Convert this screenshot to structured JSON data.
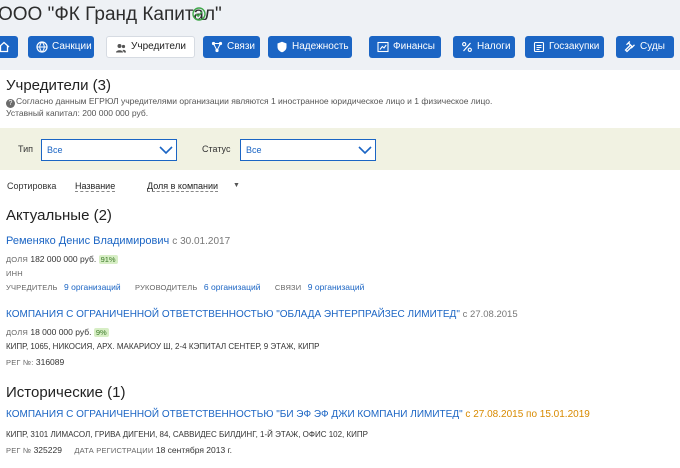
{
  "header": {
    "company_name": "ООО \"ФК Гранд Капитал\""
  },
  "tabs": [
    {
      "label": "",
      "icon": "home-icon"
    },
    {
      "label": "Санкции",
      "icon": "globe-icon"
    },
    {
      "label": "Учредители",
      "icon": "users-icon",
      "active": true
    },
    {
      "label": "Связи",
      "icon": "network-icon"
    },
    {
      "label": "Надежность",
      "icon": "shield-icon"
    },
    {
      "label": "Финансы",
      "icon": "chart-icon"
    },
    {
      "label": "Налоги",
      "icon": "percent-icon"
    },
    {
      "label": "Госзакупки",
      "icon": "document-icon"
    },
    {
      "label": "Суды",
      "icon": "gavel-icon"
    }
  ],
  "founders": {
    "title": "Учредители (3)",
    "note": "Согласно данным ЕГРЮЛ учредителями организации являются 1 иностранное юридическое лицо и 1 физическое лицо.",
    "capital": "Уставный капитал: 200 000 000 руб."
  },
  "filters": {
    "type_label": "Тип",
    "type_value": "Все",
    "status_label": "Статус",
    "status_value": "Все"
  },
  "sort": {
    "label": "Сортировка",
    "by_name": "Название",
    "by_share": "Доля в компании"
  },
  "actual": {
    "title": "Актуальные (2)",
    "person": {
      "name": "Ременяко Денис Владимирович",
      "since": "с 30.01.2017",
      "share_label": "ДОЛЯ",
      "share_value": "182 000 000 руб.",
      "share_pct": "91%",
      "inn_label": "ИНН",
      "founder_label": "УЧРЕДИТЕЛЬ",
      "founder_link": "9 организаций",
      "head_label": "РУКОВОДИТЕЛЬ",
      "head_link": "6 организаций",
      "links_label": "СВЯЗИ",
      "links_link": "9 организаций"
    },
    "company": {
      "name": "КОМПАНИЯ С ОГРАНИЧЕННОЙ ОТВЕТСТВЕННОСТЬЮ \"ОБЛАДА ЭНТЕРПРАЙЗЕС ЛИМИТЕД\"",
      "since": "с 27.08.2015",
      "share_label": "ДОЛЯ",
      "share_value": "18 000 000 руб.",
      "share_pct": "9%",
      "address": "КИПР, 1065, НИКОСИЯ, АРХ. МАКАРИОУ Ш, 2-4 КЭПИТАЛ СЕНТЕР, 9 ЭТАЖ, КИПР",
      "reg_label": "РЕГ №:",
      "reg_value": "316089"
    }
  },
  "historical": {
    "title": "Исторические (1)",
    "company": {
      "name": "КОМПАНИЯ С ОГРАНИЧЕННОЙ ОТВЕТСТВЕННОСТЬЮ \"БИ ЭФ ЭФ ДЖИ КОМПАНИ ЛИМИТЕД\"",
      "period": "с 27.08.2015 по 15.01.2019",
      "address": "КИПР, 3101 ЛИМАСОЛ, ГРИВА ДИГЕНИ, 84, САВВИДЕС БИЛДИНГ, 1-Й ЭТАЖ, ОФИС 102, КИПР",
      "reg_label": "РЕГ №",
      "reg_value": "325229",
      "date_label": "ДАТА РЕГИСТРАЦИИ",
      "date_value": "18 сентября 2013 г."
    }
  },
  "colors": {
    "accent": "#1b65c4",
    "ok": "#3fa84a",
    "filter_bg": "#f1f2e2",
    "period": "#d88a00"
  }
}
